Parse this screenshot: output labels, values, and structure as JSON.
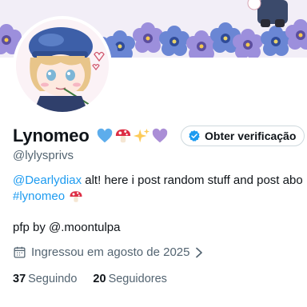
{
  "profile": {
    "display_name": "Lynomeo",
    "name_emojis": [
      "blue-heart-icon",
      "mushroom-icon",
      "sparkles-icon",
      "purple-heart-icon"
    ],
    "handle": "@lylysprivs",
    "verify_button_label": "Obter verificação",
    "bio": {
      "mention": "@Dearlydiax",
      "text": " alt! here i post random stuff and post abo",
      "hashtag": "#lynomeo",
      "hashtag_emoji": "mushroom-icon"
    },
    "pfp_credit": "pfp by @.moontulpa",
    "joined_text": "Ingressou em agosto de 2025",
    "following_count": "37",
    "following_label": "Seguindo",
    "followers_count": "20",
    "followers_label": "Seguidores"
  },
  "colors": {
    "accent": "#1d9bf0",
    "text_primary": "#0f1419",
    "text_secondary": "#536471",
    "banner_flowers_purple": "#8f7fd0",
    "banner_flowers_blue": "#5a77c4"
  }
}
